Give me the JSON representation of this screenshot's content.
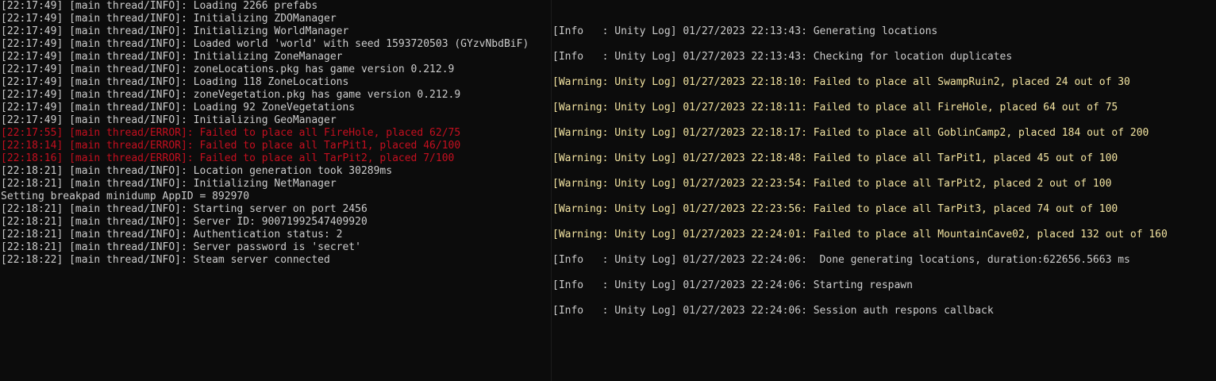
{
  "colors": {
    "background": "#0c0c0c",
    "text": "#cccccc",
    "error": "#c50f1f",
    "warning": "#f2e3a0"
  },
  "left_console": {
    "lines": [
      {
        "level": "info",
        "text": "[22:17:49] [main thread/INFO]: Loading 2266 prefabs"
      },
      {
        "level": "info",
        "text": "[22:17:49] [main thread/INFO]: Initializing ZDOManager"
      },
      {
        "level": "info",
        "text": "[22:17:49] [main thread/INFO]: Initializing WorldManager"
      },
      {
        "level": "info",
        "text": "[22:17:49] [main thread/INFO]: Loaded world 'world' with seed 1593720503 (GYzvNbdBiF)"
      },
      {
        "level": "info",
        "text": "[22:17:49] [main thread/INFO]: Initializing ZoneManager"
      },
      {
        "level": "info",
        "text": "[22:17:49] [main thread/INFO]: zoneLocations.pkg has game version 0.212.9"
      },
      {
        "level": "info",
        "text": "[22:17:49] [main thread/INFO]: Loading 118 ZoneLocations"
      },
      {
        "level": "info",
        "text": "[22:17:49] [main thread/INFO]: zoneVegetation.pkg has game version 0.212.9"
      },
      {
        "level": "info",
        "text": "[22:17:49] [main thread/INFO]: Loading 92 ZoneVegetations"
      },
      {
        "level": "info",
        "text": "[22:17:49] [main thread/INFO]: Initializing GeoManager"
      },
      {
        "level": "error",
        "text": "[22:17:55] [main thread/ERROR]: Failed to place all FireHole, placed 62/75"
      },
      {
        "level": "error",
        "text": "[22:18:14] [main thread/ERROR]: Failed to place all TarPit1, placed 46/100"
      },
      {
        "level": "error",
        "text": "[22:18:16] [main thread/ERROR]: Failed to place all TarPit2, placed 7/100"
      },
      {
        "level": "info",
        "text": "[22:18:21] [main thread/INFO]: Location generation took 30289ms"
      },
      {
        "level": "info",
        "text": "[22:18:21] [main thread/INFO]: Initializing NetManager"
      },
      {
        "level": "info",
        "text": "Setting breakpad minidump AppID = 892970"
      },
      {
        "level": "info",
        "text": "[22:18:21] [main thread/INFO]: Starting server on port 2456"
      },
      {
        "level": "info",
        "text": "[22:18:21] [main thread/INFO]: Server ID: 90071992547409920"
      },
      {
        "level": "info",
        "text": "[22:18:21] [main thread/INFO]: Authentication status: 2"
      },
      {
        "level": "info",
        "text": "[22:18:21] [main thread/INFO]: Server password is 'secret'"
      },
      {
        "level": "info",
        "text": "[22:18:22] [main thread/INFO]: Steam server connected"
      }
    ]
  },
  "right_console": {
    "lines": [
      {
        "level": "info",
        "text": "[Info   : Unity Log] 01/27/2023 22:13:43: Generating locations"
      },
      {
        "level": "info",
        "text": "[Info   : Unity Log] 01/27/2023 22:13:43: Checking for location duplicates"
      },
      {
        "level": "warning",
        "text": "[Warning: Unity Log] 01/27/2023 22:18:10: Failed to place all SwampRuin2, placed 24 out of 30"
      },
      {
        "level": "warning",
        "text": "[Warning: Unity Log] 01/27/2023 22:18:11: Failed to place all FireHole, placed 64 out of 75"
      },
      {
        "level": "warning",
        "text": "[Warning: Unity Log] 01/27/2023 22:18:17: Failed to place all GoblinCamp2, placed 184 out of 200"
      },
      {
        "level": "warning",
        "text": "[Warning: Unity Log] 01/27/2023 22:18:48: Failed to place all TarPit1, placed 45 out of 100"
      },
      {
        "level": "warning",
        "text": "[Warning: Unity Log] 01/27/2023 22:23:54: Failed to place all TarPit2, placed 2 out of 100"
      },
      {
        "level": "warning",
        "text": "[Warning: Unity Log] 01/27/2023 22:23:56: Failed to place all TarPit3, placed 74 out of 100"
      },
      {
        "level": "warning",
        "text": "[Warning: Unity Log] 01/27/2023 22:24:01: Failed to place all MountainCave02, placed 132 out of 160"
      },
      {
        "level": "info",
        "text": "[Info   : Unity Log] 01/27/2023 22:24:06:  Done generating locations, duration:622656.5663 ms"
      },
      {
        "level": "info",
        "text": "[Info   : Unity Log] 01/27/2023 22:24:06: Starting respawn"
      },
      {
        "level": "info",
        "text": "[Info   : Unity Log] 01/27/2023 22:24:06: Session auth respons callback"
      }
    ]
  }
}
